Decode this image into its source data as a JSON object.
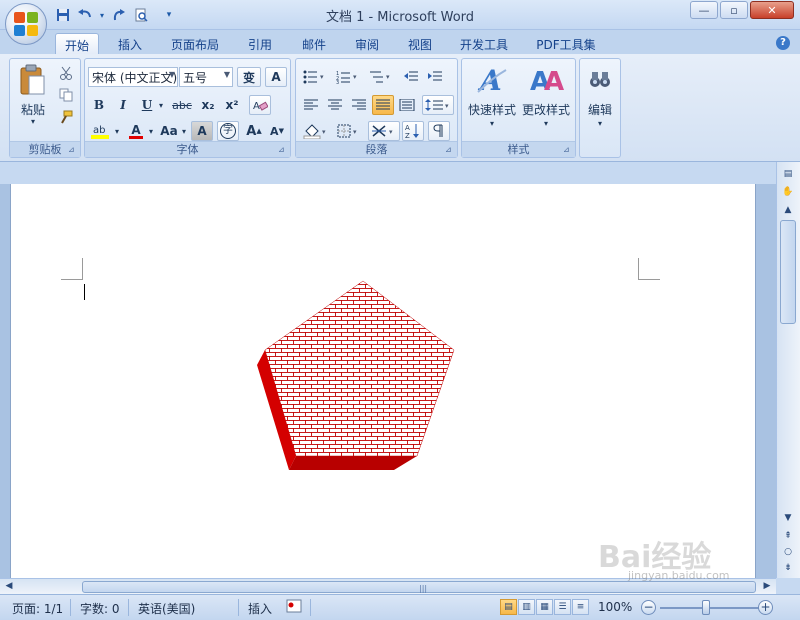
{
  "window": {
    "title": "文档 1 - Microsoft Word",
    "minimize": "—",
    "restore": "▫",
    "close": "✕"
  },
  "qat": {
    "save_icon": "save-icon",
    "undo_icon": "undo-icon",
    "redo_icon": "redo-icon",
    "preview_icon": "print-preview-icon",
    "customize_icon": "chevron-down-icon"
  },
  "tabs": [
    {
      "label": "开始",
      "active": true
    },
    {
      "label": "插入"
    },
    {
      "label": "页面布局"
    },
    {
      "label": "引用"
    },
    {
      "label": "邮件"
    },
    {
      "label": "审阅"
    },
    {
      "label": "视图"
    },
    {
      "label": "开发工具"
    },
    {
      "label": "PDF工具集"
    }
  ],
  "ribbon": {
    "clipboard": {
      "label": "剪贴板",
      "paste": "粘贴"
    },
    "font": {
      "label": "字体",
      "font_name": "宋体 (中文正文)",
      "font_size": "五号",
      "bold": "B",
      "italic": "I",
      "underline": "U",
      "strike": "abc",
      "subscript": "x₂",
      "superscript": "x²",
      "text_color": "A",
      "case": "Aa",
      "char_shading": "A",
      "enclose": "字",
      "grow": "A",
      "shrink": "A",
      "phonetic": "变",
      "border": "A"
    },
    "paragraph": {
      "label": "段落"
    },
    "styles": {
      "label": "样式",
      "quick_styles": "快速样式",
      "change_styles": "更改样式"
    },
    "editing": {
      "label": "编辑"
    }
  },
  "status": {
    "page": "页面: 1/1",
    "words": "字数: 0",
    "language": "英语(美国)",
    "mode": "插入",
    "zoom": "100%"
  },
  "watermark": {
    "text": "Bai经验",
    "sub": "jingyan.baidu.com"
  },
  "colors": {
    "accent": "#15428b",
    "shape_fill_red": "#e00000",
    "shape_pattern_bg": "#ffffff"
  }
}
